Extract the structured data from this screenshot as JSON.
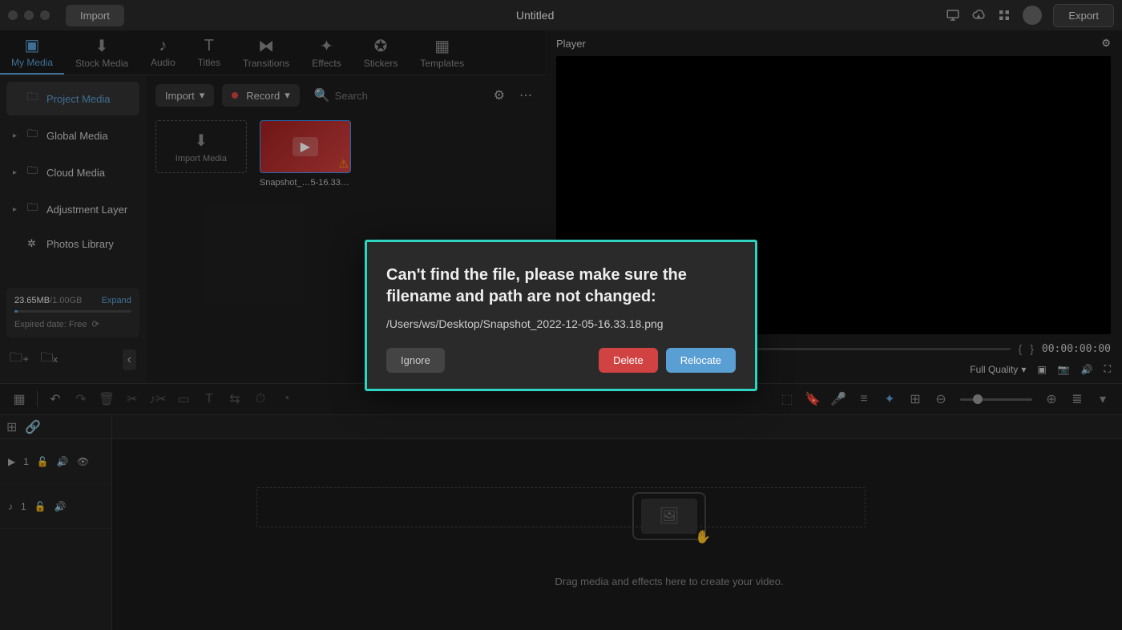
{
  "titlebar": {
    "import_btn": "Import",
    "title": "Untitled",
    "export_btn": "Export"
  },
  "tabs": [
    {
      "label": "My Media"
    },
    {
      "label": "Stock Media"
    },
    {
      "label": "Audio"
    },
    {
      "label": "Titles"
    },
    {
      "label": "Transitions"
    },
    {
      "label": "Effects"
    },
    {
      "label": "Stickers"
    },
    {
      "label": "Templates"
    }
  ],
  "sidebar": {
    "items": [
      {
        "label": "Project Media"
      },
      {
        "label": "Global Media"
      },
      {
        "label": "Cloud Media"
      },
      {
        "label": "Adjustment Layer"
      },
      {
        "label": "Photos Library"
      }
    ],
    "storage": {
      "used": "23.65MB",
      "total": "/1.00GB",
      "expand": "Expand",
      "expired": "Expired date: Free"
    }
  },
  "media_toolbar": {
    "import_dd": "Import",
    "record_dd": "Record",
    "search_placeholder": "Search"
  },
  "media_grid": {
    "import_tile": "Import Media",
    "thumb_label": "Snapshot_…5-16.33.18"
  },
  "player": {
    "header": "Player",
    "timecode": "00:00:00:00",
    "quality": "Full Quality"
  },
  "timeline": {
    "track_v_num": "1",
    "track_a_num": "1",
    "drop_text": "Drag media and effects here to create your video."
  },
  "modal": {
    "title": "Can't find the file, please make sure the filename and path are not changed:",
    "path": "/Users/ws/Desktop/Snapshot_2022-12-05-16.33.18.png",
    "ignore": "Ignore",
    "delete": "Delete",
    "relocate": "Relocate"
  }
}
